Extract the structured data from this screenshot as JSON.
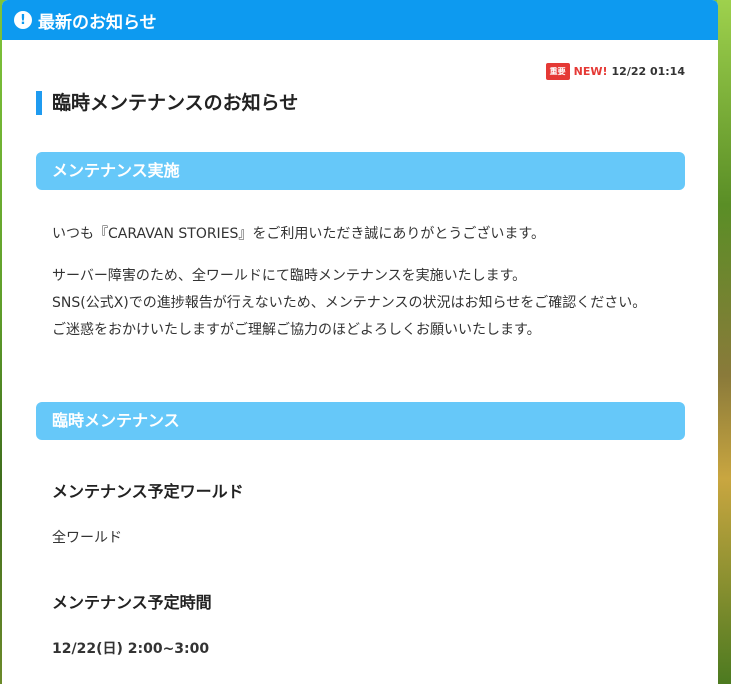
{
  "header": {
    "title": "最新のお知らせ",
    "icon": "exclamation-circle-icon"
  },
  "meta": {
    "important_badge": "重要",
    "new_badge": "NEW!",
    "datetime": "12/22 01:14"
  },
  "article": {
    "title": "臨時メンテナンスのお知らせ",
    "section1": {
      "heading": "メンテナンス実施",
      "intro": "いつも『CARAVAN STORIES』をご利用いただき誠にありがとうございます。",
      "body_line1": "サーバー障害のため、全ワールドにて臨時メンテナンスを実施いたします。",
      "body_line2": "SNS(公式X)での進捗報告が行えないため、メンテナンスの状況はお知らせをご確認ください。",
      "body_line3": "ご迷惑をおかけいたしますがご理解ご協力のほどよろしくお願いいたします。"
    },
    "section2": {
      "heading": "臨時メンテナンス",
      "world_heading": "メンテナンス予定ワールド",
      "world_value": "全ワールド",
      "time_heading": "メンテナンス予定時間",
      "time_value": "12/22(日) 2:00~3:00"
    }
  },
  "colors": {
    "header_blue": "#0d9af0",
    "section_blue": "#66c8f9",
    "accent_red": "#e53935"
  }
}
